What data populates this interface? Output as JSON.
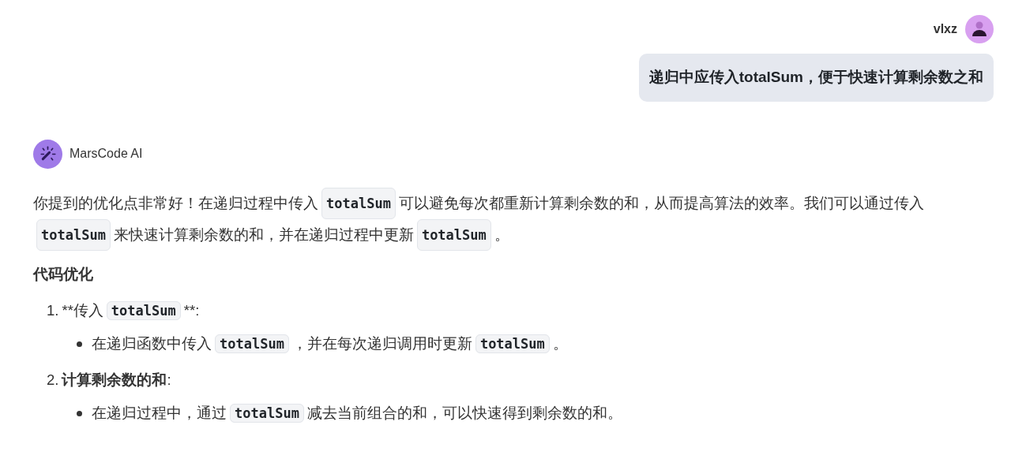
{
  "user_message": {
    "name": "vlxz",
    "text": "递归中应传入totalSum，便于快速计算剩余数之和"
  },
  "assistant": {
    "name": "MarsCode AI",
    "paragraph": [
      {
        "kind": "text",
        "text": "你提到的优化点非常好！在递归过程中传入"
      },
      {
        "kind": "code",
        "text": "totalSum"
      },
      {
        "kind": "text",
        "text": "可以避免每次都重新计算剩余数的和，从而提高算法的效率。我们可以通过传入"
      },
      {
        "kind": "code",
        "text": "totalSum"
      },
      {
        "kind": "text",
        "text": "来快速计算剩余数的和，并在递归过程中更新"
      },
      {
        "kind": "code",
        "text": "totalSum"
      },
      {
        "kind": "text",
        "text": "。"
      }
    ],
    "heading": "代码优化",
    "list": [
      {
        "number": "1.",
        "segments": [
          {
            "kind": "text",
            "text": "**传入"
          },
          {
            "kind": "code",
            "text": "totalSum"
          },
          {
            "kind": "text",
            "text": "**:"
          }
        ],
        "bullets": [
          [
            {
              "kind": "text",
              "text": "在递归函数中传入"
            },
            {
              "kind": "code",
              "text": "totalSum"
            },
            {
              "kind": "text",
              "text": "，并在每次递归调用时更新"
            },
            {
              "kind": "code",
              "text": "totalSum"
            },
            {
              "kind": "text",
              "text": "。"
            }
          ]
        ]
      },
      {
        "number": "2.",
        "segments": [
          {
            "kind": "bold",
            "text": "计算剩余数的和"
          },
          {
            "kind": "text",
            "text": ":"
          }
        ],
        "bullets": [
          [
            {
              "kind": "text",
              "text": "在递归过程中，通过"
            },
            {
              "kind": "code",
              "text": "totalSum"
            },
            {
              "kind": "text",
              "text": "减去当前组合的和，可以快速得到剩余数的和。"
            }
          ]
        ]
      }
    ]
  }
}
